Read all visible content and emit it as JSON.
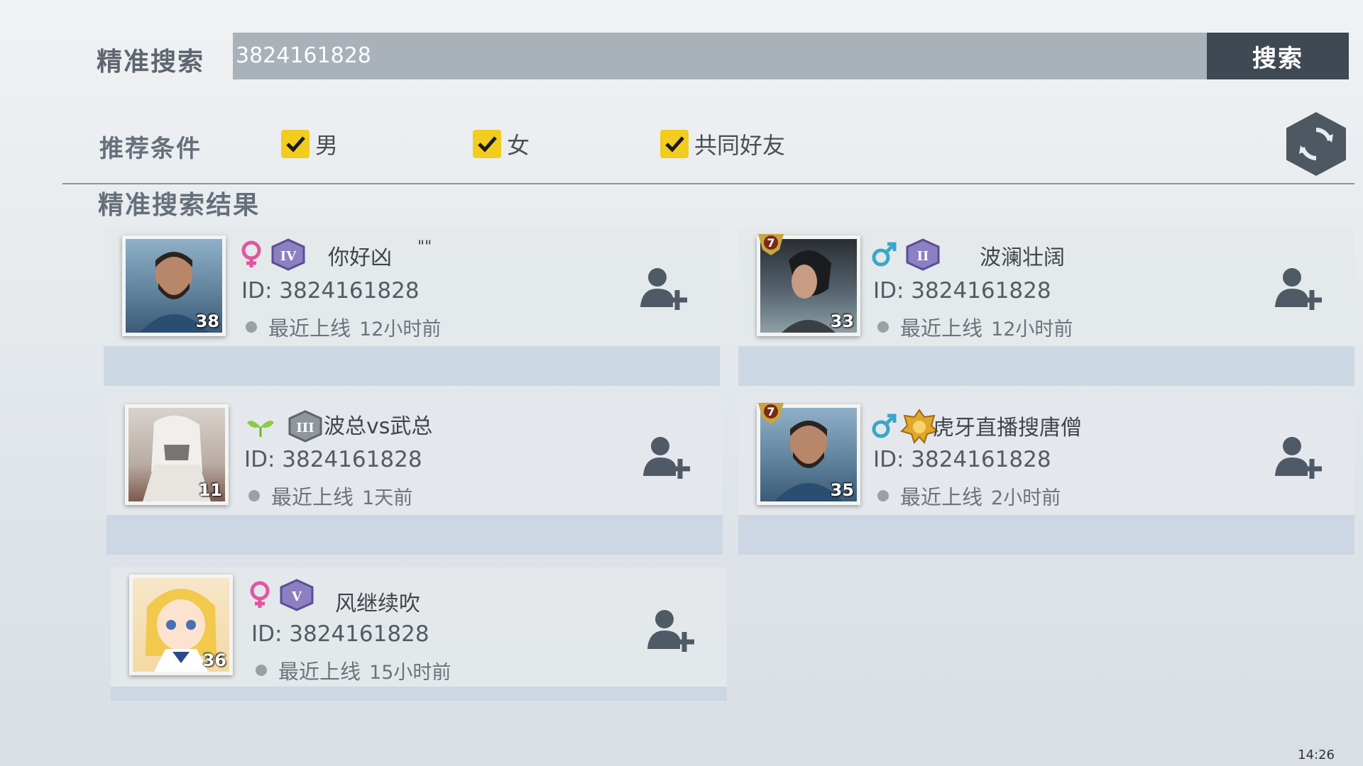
{
  "search": {
    "label": "精准搜索",
    "value": "3824161828",
    "button_label": "搜索"
  },
  "filters": {
    "label": "推荐条件",
    "options": [
      {
        "label": "男",
        "checked": true
      },
      {
        "label": "女",
        "checked": true
      },
      {
        "label": "共同好友",
        "checked": true
      }
    ]
  },
  "results": {
    "title": "精准搜索结果",
    "players": [
      {
        "name": "你好凶",
        "name_suffix": "\"\"",
        "id": "ID: 3824161828",
        "status": "最近上线",
        "time": "12小时前",
        "level": "38",
        "gender": "female",
        "rank": "IV"
      },
      {
        "name": "波澜壮阔",
        "id": "ID: 3824161828",
        "status": "最近上线",
        "time": "12小时前",
        "level": "33",
        "gender": "male",
        "rank": "II",
        "badge": "7"
      },
      {
        "name": "波总vs武总",
        "id": "ID: 3824161828",
        "status": "最近上线",
        "time": "1天前",
        "level": "11",
        "gender": "newbie",
        "rank": "III"
      },
      {
        "name": "虎牙直播搜唐僧",
        "id": "ID: 3824161828",
        "status": "最近上线",
        "time": "2小时前",
        "level": "35",
        "gender": "male",
        "rank": "gold",
        "badge": "7"
      },
      {
        "name": "风继续吹",
        "id": "ID: 3824161828",
        "status": "最近上线",
        "time": "15小时前",
        "level": "36",
        "gender": "female",
        "rank": "V"
      }
    ]
  },
  "taskbar": {
    "time": "14:26"
  },
  "colors": {
    "accent_check": "#f2cc1f",
    "button_dark": "#3f4953",
    "female_icon": "#e3559e",
    "male_icon": "#3aa6c8"
  }
}
